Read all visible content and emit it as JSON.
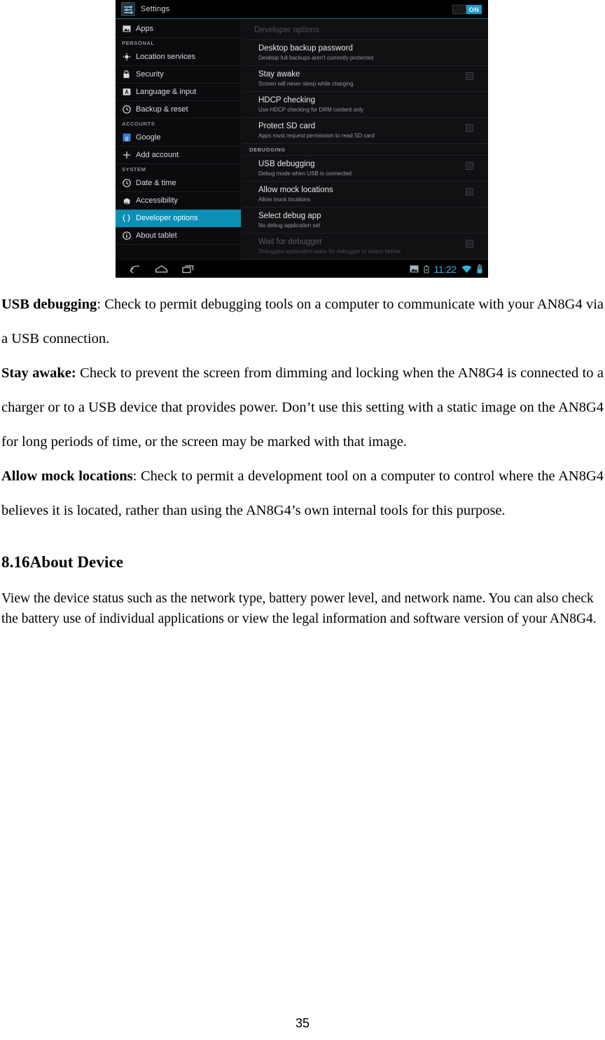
{
  "screenshot": {
    "actionbar": {
      "app_icon": "settings-icon",
      "title": "Settings",
      "toggle_label": "ON"
    },
    "sidebar": [
      {
        "type": "item",
        "icon": "apps-icon",
        "label": "Apps",
        "selected": false
      },
      {
        "type": "header",
        "label": "PERSONAL"
      },
      {
        "type": "item",
        "icon": "location-icon",
        "label": "Location services",
        "selected": false
      },
      {
        "type": "item",
        "icon": "lock-icon",
        "label": "Security",
        "selected": false
      },
      {
        "type": "item",
        "icon": "language-icon",
        "label": "Language & input",
        "selected": false
      },
      {
        "type": "item",
        "icon": "backup-icon",
        "label": "Backup & reset",
        "selected": false
      },
      {
        "type": "header",
        "label": "ACCOUNTS"
      },
      {
        "type": "item",
        "icon": "google-icon",
        "label": "Google",
        "selected": false
      },
      {
        "type": "item",
        "icon": "plus-icon",
        "label": "Add account",
        "selected": false
      },
      {
        "type": "header",
        "label": "SYSTEM"
      },
      {
        "type": "item",
        "icon": "clock-icon",
        "label": "Date & time",
        "selected": false
      },
      {
        "type": "item",
        "icon": "accessibility-icon",
        "label": "Accessibility",
        "selected": false
      },
      {
        "type": "item",
        "icon": "braces-icon",
        "label": "Developer options",
        "selected": true
      },
      {
        "type": "item",
        "icon": "info-icon",
        "label": "About tablet",
        "selected": false
      }
    ],
    "pane": {
      "title": "Developer options",
      "rows": [
        {
          "type": "row",
          "title": "Desktop backup password",
          "subtitle": "Desktop full backups aren't currently protected",
          "checkbox": false,
          "dim": false
        },
        {
          "type": "row",
          "title": "Stay awake",
          "subtitle": "Screen will never sleep while charging",
          "checkbox": true,
          "checked": false,
          "dim": false
        },
        {
          "type": "row",
          "title": "HDCP checking",
          "subtitle": "Use HDCP checking for DRM content only",
          "checkbox": false,
          "dim": false
        },
        {
          "type": "row",
          "title": "Protect SD card",
          "subtitle": "Apps must request permission to read SD card",
          "checkbox": true,
          "checked": false,
          "dim": false
        },
        {
          "type": "section",
          "label": "DEBUGGING"
        },
        {
          "type": "row",
          "title": "USB debugging",
          "subtitle": "Debug mode when USB is connected",
          "checkbox": true,
          "checked": false,
          "dim": false
        },
        {
          "type": "row",
          "title": "Allow mock locations",
          "subtitle": "Allow mock locations",
          "checkbox": true,
          "checked": false,
          "dim": false
        },
        {
          "type": "row",
          "title": "Select debug app",
          "subtitle": "No debug application set",
          "checkbox": false,
          "dim": false
        },
        {
          "type": "row",
          "title": "Wait for debugger",
          "subtitle": "Debugged application waits for debugger to attach before",
          "checkbox": true,
          "checked": false,
          "dim": true
        }
      ]
    },
    "navbar": {
      "back_icon": "back-arrow-icon",
      "home_icon": "home-icon",
      "recents_icon": "recent-apps-icon",
      "screenshot_icon": "screenshot-icon",
      "usb_icon": "usb-storage-icon",
      "clock": "11:22",
      "wifi_icon": "wifi-icon",
      "battery_icon": "battery-icon"
    }
  },
  "document": {
    "paragraphs": [
      {
        "lead": "USB debugging",
        "sep": ": ",
        "body": "Check to permit debugging tools on a computer to communicate with your AN8G4 via a USB connection."
      },
      {
        "lead": "Stay awake:",
        "sep": " ",
        "body": "Check to prevent the screen from dimming and locking when the AN8G4 is connected to a charger or to a USB device that provides power. Don’t use this setting with a static image on the AN8G4 for long periods of time, or the screen may be marked with that image."
      },
      {
        "lead": "Allow mock locations",
        "sep": ": ",
        "body": "Check to permit a development tool on a computer to control where the AN8G4 believes it is located, rather than using the AN8G4’s own internal tools for this purpose."
      }
    ],
    "section_heading": "8.16About Device",
    "section_body": "View the device status such as the network type, battery power level, and network name. You can also check the battery use of individual applications or view the legal information and software version of your AN8G4.",
    "page_number": "35"
  }
}
